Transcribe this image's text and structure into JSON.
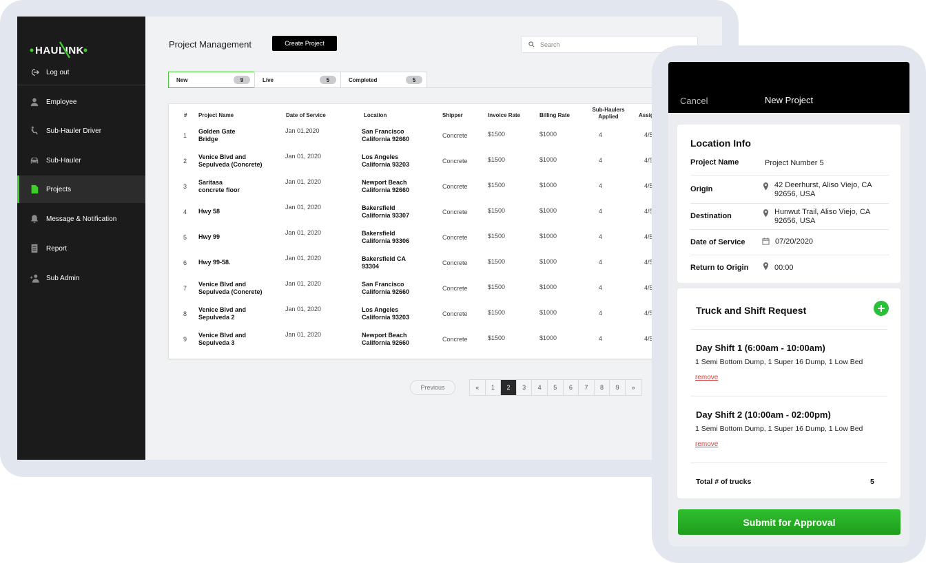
{
  "app": {
    "logo_text": "HAULINK",
    "logout_label": "Log out"
  },
  "sidebar": {
    "items": [
      {
        "label": "Employee",
        "icon": "person-icon"
      },
      {
        "label": "Sub-Hauler Driver",
        "icon": "driver-seat-icon"
      },
      {
        "label": "Sub-Hauler",
        "icon": "car-icon"
      },
      {
        "label": "Projects",
        "icon": "document-icon",
        "active": true
      },
      {
        "label": "Message & Notification",
        "icon": "bell-icon"
      },
      {
        "label": "Report",
        "icon": "report-icon"
      },
      {
        "label": "Sub Admin",
        "icon": "add-user-icon"
      }
    ]
  },
  "header": {
    "title": "Project Management",
    "create_label": "Create Project",
    "search_placeholder": "Search"
  },
  "tabs": [
    {
      "label": "New",
      "count": "9",
      "active": true
    },
    {
      "label": "Live",
      "count": "5"
    },
    {
      "label": "Completed",
      "count": "5"
    }
  ],
  "table": {
    "headers": {
      "num": "#",
      "name": "Project Name",
      "date": "Date of Service",
      "location": "Location",
      "shipper": "Shipper",
      "invoice": "Invoice Rate",
      "billing": "Billing Rate",
      "applied_1": "Sub-Haulers",
      "applied_2": "Applied",
      "assigned": "Assig"
    },
    "rows": [
      {
        "num": "1",
        "name1": "Golden Gate",
        "name2": "Bridge",
        "date": "Jan 01,2020",
        "loc1": "San Francisco",
        "loc2": "California 92660",
        "shipper": "Concrete",
        "invoice": "$1500",
        "billing": "$1000",
        "applied": "4",
        "assigned": "4/5"
      },
      {
        "num": "2",
        "name1": "Venice Blvd and",
        "name2": "Sepulveda (Concrete)",
        "date": "Jan  01, 2020",
        "loc1": "Los Angeles",
        "loc2": "California 93203",
        "shipper": "Concrete",
        "invoice": "$1500",
        "billing": "$1000",
        "applied": "4",
        "assigned": "4/5"
      },
      {
        "num": "3",
        "name1": "Saritasa",
        "name2": "concrete floor",
        "date": "Jan 01, 2020",
        "loc1": "Newport Beach",
        "loc2": "California 92660",
        "shipper": "Concrete",
        "invoice": "$1500",
        "billing": "$1000",
        "applied": "4",
        "assigned": "4/5"
      },
      {
        "num": "4",
        "name1": "Hwy 58",
        "name2": "",
        "date": "Jan 01, 2020",
        "loc1": "Bakersfield",
        "loc2": "California 93307",
        "shipper": "Concrete",
        "invoice": "$1500",
        "billing": "$1000",
        "applied": "4",
        "assigned": "4/5"
      },
      {
        "num": "5",
        "name1": "Hwy 99",
        "name2": "",
        "date": "Jan 01, 2020",
        "loc1": "Bakersfield",
        "loc2": "California 93306",
        "shipper": "Concrete",
        "invoice": "$1500",
        "billing": "$1000",
        "applied": "4",
        "assigned": "4/5"
      },
      {
        "num": "6",
        "name1": "Hwy 99-58.",
        "name2": "",
        "date": "Jan 01, 2020",
        "loc1": "Bakersfield CA",
        "loc2": "93304",
        "shipper": "Concrete",
        "invoice": "$1500",
        "billing": "$1000",
        "applied": "4",
        "assigned": "4/5"
      },
      {
        "num": "7",
        "name1": "Venice Blvd and",
        "name2": "Sepulveda (Concrete)",
        "date": "Jan 01, 2020",
        "loc1": "San Francisco",
        "loc2": "California 92660",
        "shipper": "Concrete",
        "invoice": "$1500",
        "billing": "$1000",
        "applied": "4",
        "assigned": "4/5"
      },
      {
        "num": "8",
        "name1": "Venice Blvd and",
        "name2": "Sepulveda 2",
        "date": "Jan 01, 2020",
        "loc1": "Los Angeles",
        "loc2": "California 93203",
        "shipper": "Concrete",
        "invoice": "$1500",
        "billing": "$1000",
        "applied": "4",
        "assigned": "4/5"
      },
      {
        "num": "9",
        "name1": "Venice Blvd and",
        "name2": "Sepulveda 3",
        "date": "Jan 01, 2020",
        "loc1": "Newport Beach",
        "loc2": "California 92660",
        "shipper": "Concrete",
        "invoice": "$1500",
        "billing": "$1000",
        "applied": "4",
        "assigned": "4/5"
      }
    ]
  },
  "pagination": {
    "previous_label": "Previous",
    "first": "«",
    "last": "»",
    "pages": [
      "1",
      "2",
      "3",
      "4",
      "5",
      "6",
      "7",
      "8",
      "9"
    ],
    "active_page": "2"
  },
  "mobile": {
    "cancel_label": "Cancel",
    "title": "New Project",
    "location_info": {
      "title": "Location Info",
      "project_name_label": "Project Name",
      "project_name_value": "Project Number 5",
      "origin_label": "Origin",
      "origin_line1": "42 Deerhurst, Aliso Viejo, CA",
      "origin_line2": "92656, USA",
      "destination_label": "Destination",
      "destination_line1": "Hunwut Trail, Aliso Viejo, CA",
      "destination_line2": "92656, USA",
      "date_label": "Date of  Service",
      "date_value": "07/20/2020",
      "return_label": "Return to Origin",
      "return_value": "00:00"
    },
    "truck": {
      "title": "Truck and Shift Request",
      "shifts": [
        {
          "title": "Day Shift 1 (6:00am - 10:00am)",
          "desc": "1 Semi Bottom Dump, 1 Super 16 Dump, 1 Low Bed",
          "remove": "remove"
        },
        {
          "title": "Day Shift 2 (10:00am - 02:00pm)",
          "desc": "1 Semi Bottom Dump, 1 Super 16 Dump, 1 Low Bed",
          "remove": "remove"
        }
      ],
      "total_label": "Total # of trucks",
      "total_value": "5"
    },
    "submit_label": "Submit for Approval"
  },
  "colors": {
    "accent": "#3ecf2a",
    "sidebar_bg": "#1b1b1b",
    "submit": "#22a622"
  }
}
